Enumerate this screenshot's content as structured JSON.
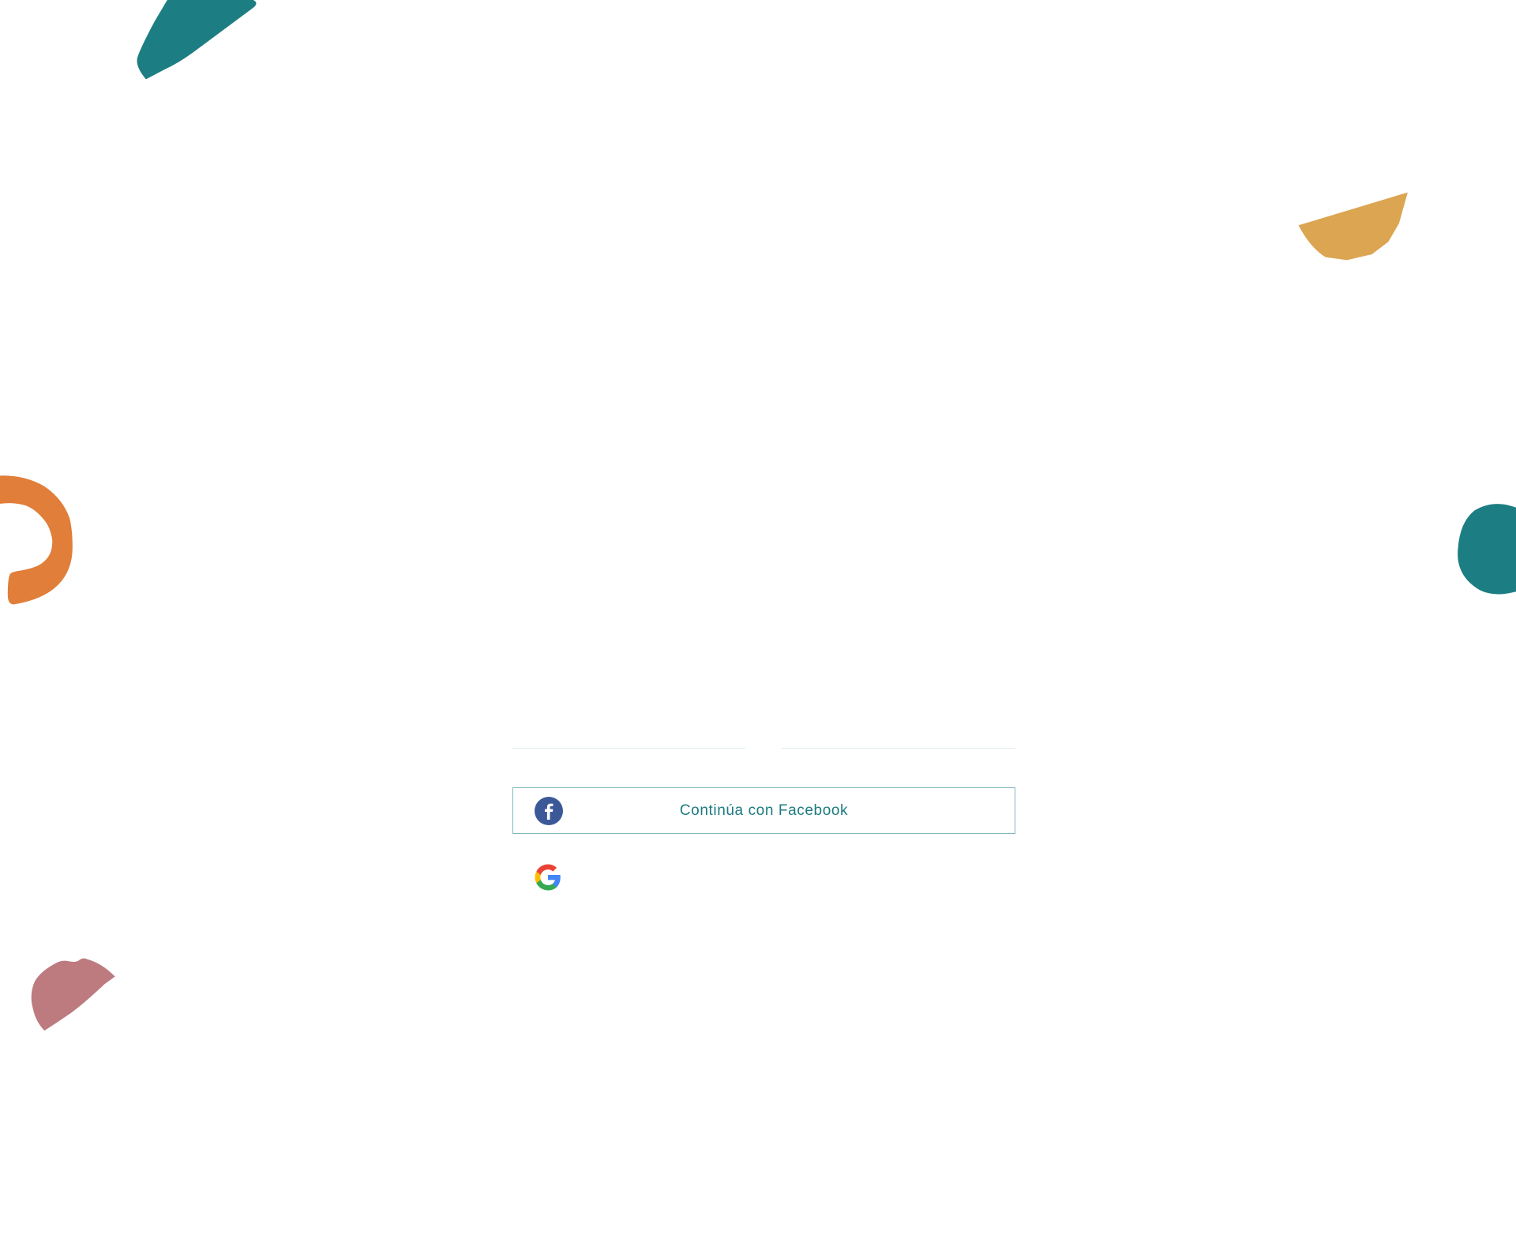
{
  "colors": {
    "teal": "#1c7e82",
    "orange": "#e07e3a",
    "mustard": "#dba552",
    "rose": "#bd7b7f",
    "facebook_blue": "#3b5998",
    "button_text": "#1c7b80",
    "button_border": "#7fb9be"
  },
  "social_login": {
    "facebook": {
      "label": "Continúa con Facebook",
      "icon": "facebook-icon"
    },
    "google": {
      "icon": "google-icon"
    }
  }
}
